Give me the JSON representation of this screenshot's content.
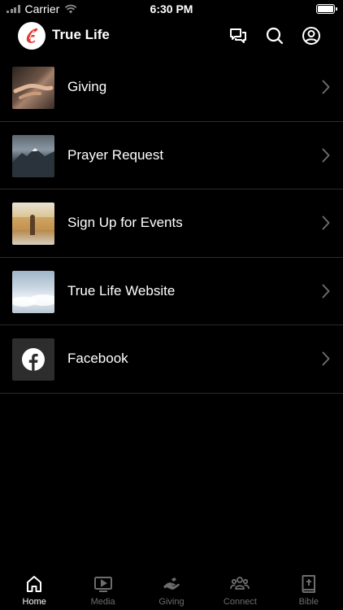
{
  "status_bar": {
    "carrier": "Carrier",
    "time": "6:30 PM"
  },
  "header": {
    "title": "True Life"
  },
  "list": {
    "items": [
      {
        "label": "Giving",
        "thumb": "giving-hands-photo"
      },
      {
        "label": "Prayer Request",
        "thumb": "mountain-photo"
      },
      {
        "label": "Sign Up for Events",
        "thumb": "street-photo"
      },
      {
        "label": "True Life Website",
        "thumb": "clouds-photo"
      },
      {
        "label": "Facebook",
        "thumb": "facebook-icon"
      }
    ]
  },
  "tabbar": {
    "tabs": [
      {
        "label": "Home",
        "icon": "home-icon",
        "active": true
      },
      {
        "label": "Media",
        "icon": "play-icon",
        "active": false
      },
      {
        "label": "Giving",
        "icon": "giving-hand-icon",
        "active": false
      },
      {
        "label": "Connect",
        "icon": "people-icon",
        "active": false
      },
      {
        "label": "Bible",
        "icon": "bible-icon",
        "active": false
      }
    ]
  },
  "colors": {
    "background": "#000000",
    "text": "#ffffff",
    "inactive_tab": "#6d6d6d",
    "logo_red": "#e53935",
    "divider": "#2b2b2b"
  }
}
